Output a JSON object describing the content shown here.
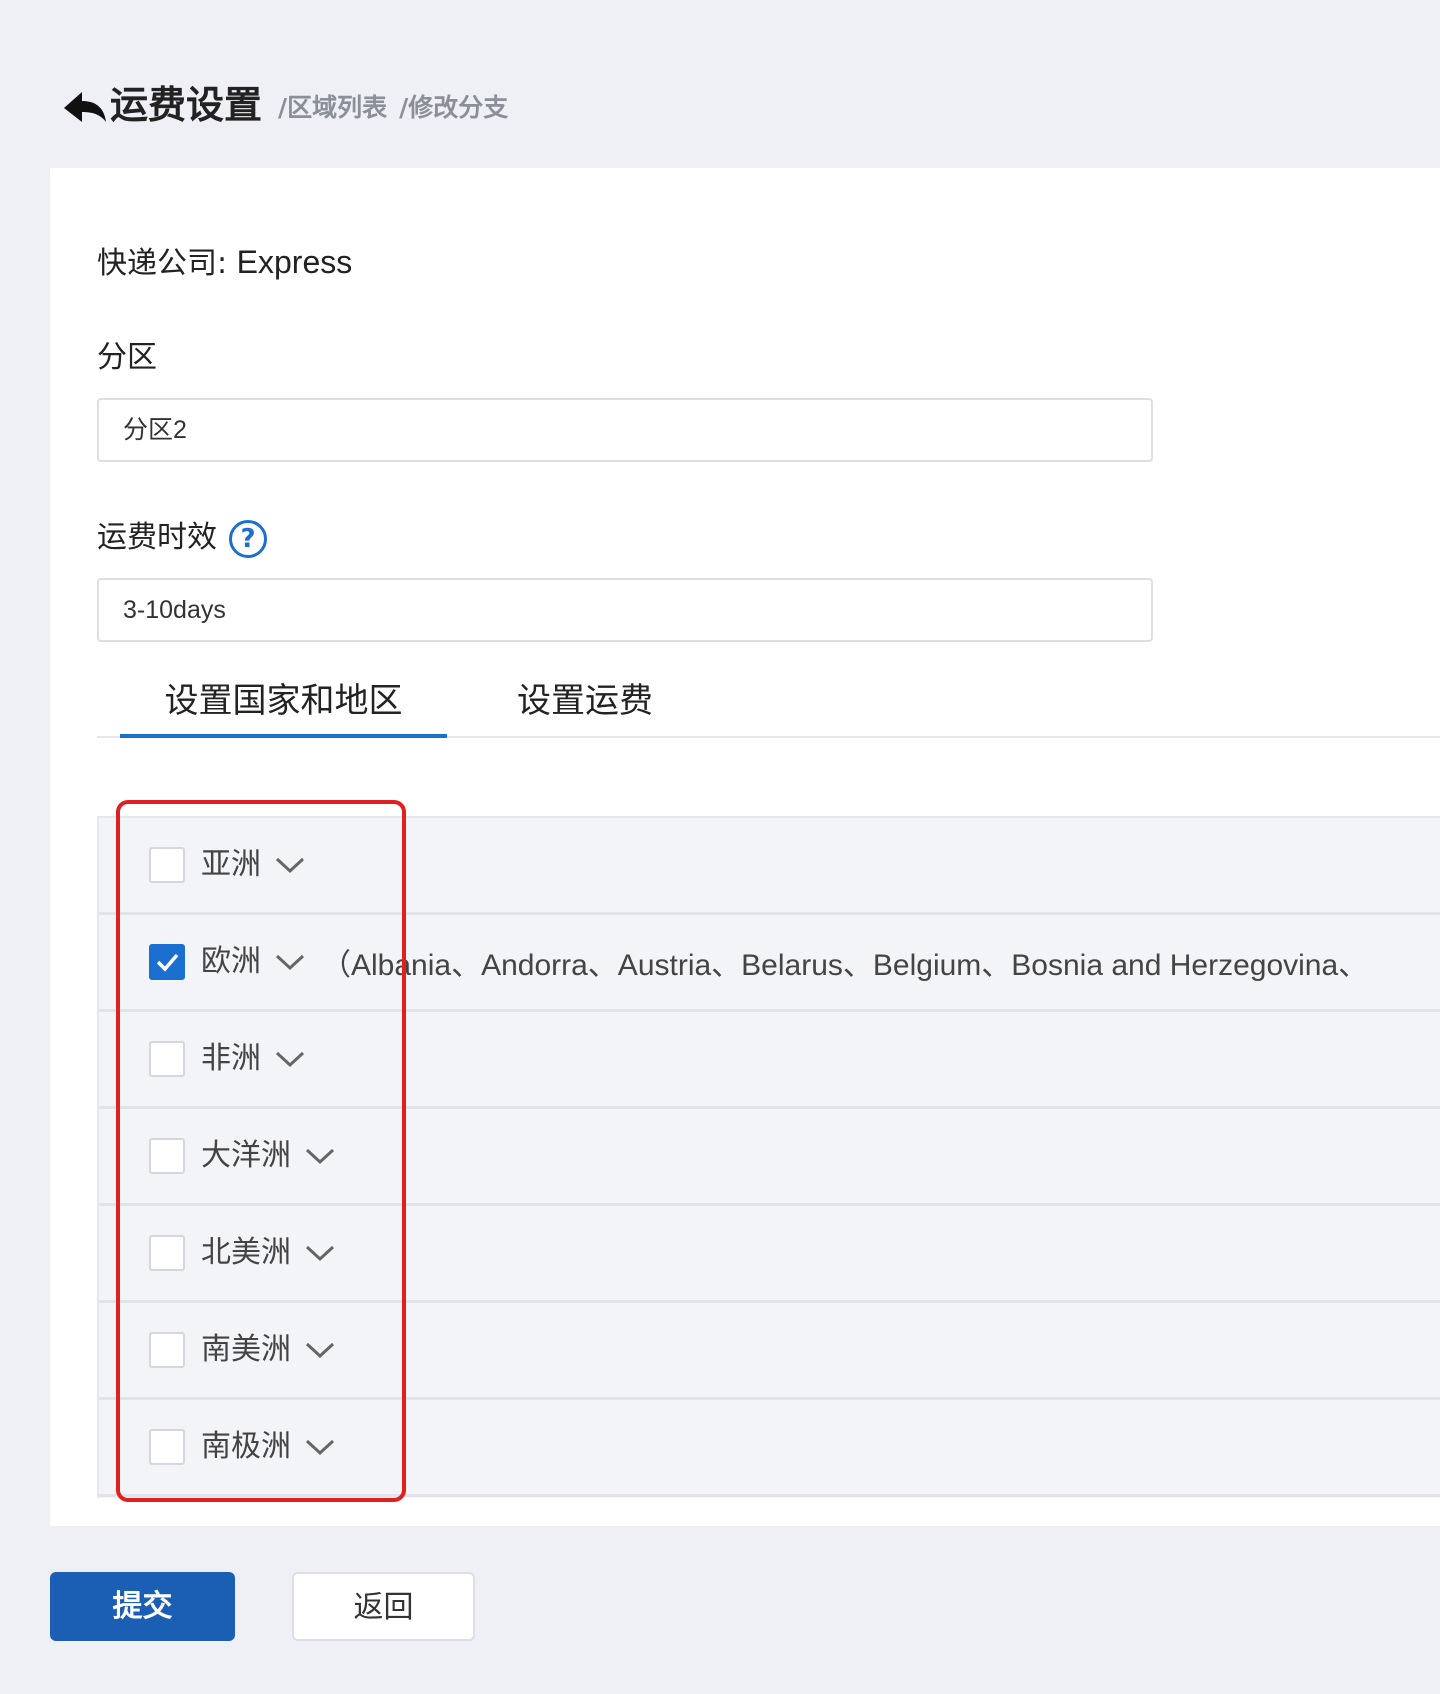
{
  "header": {
    "title": "运费设置",
    "breadcrumb": [
      "/区域列表",
      "/修改分支"
    ]
  },
  "form": {
    "courier_label": "快递公司:",
    "courier_value": "Express",
    "zone_label": "分区",
    "zone_value": "分区2",
    "delivery_time_label": "运费时效",
    "help_icon_glyph": "?",
    "delivery_time_value": "3-10days"
  },
  "tabs": [
    {
      "label": "设置国家和地区",
      "active": true
    },
    {
      "label": "设置运费",
      "active": false
    }
  ],
  "regions": [
    {
      "name": "亚洲",
      "checked": false,
      "countries": ""
    },
    {
      "name": "欧洲",
      "checked": true,
      "countries": "（Albania、Andorra、Austria、Belarus、Belgium、Bosnia and Herzegovina、"
    },
    {
      "name": "非洲",
      "checked": false,
      "countries": ""
    },
    {
      "name": "大洋洲",
      "checked": false,
      "countries": ""
    },
    {
      "name": "北美洲",
      "checked": false,
      "countries": ""
    },
    {
      "name": "南美洲",
      "checked": false,
      "countries": ""
    },
    {
      "name": "南极洲",
      "checked": false,
      "countries": ""
    }
  ],
  "buttons": {
    "submit": "提交",
    "back": "返回"
  },
  "colors": {
    "accent": "#1b6fd0",
    "highlight": "#e02020"
  }
}
